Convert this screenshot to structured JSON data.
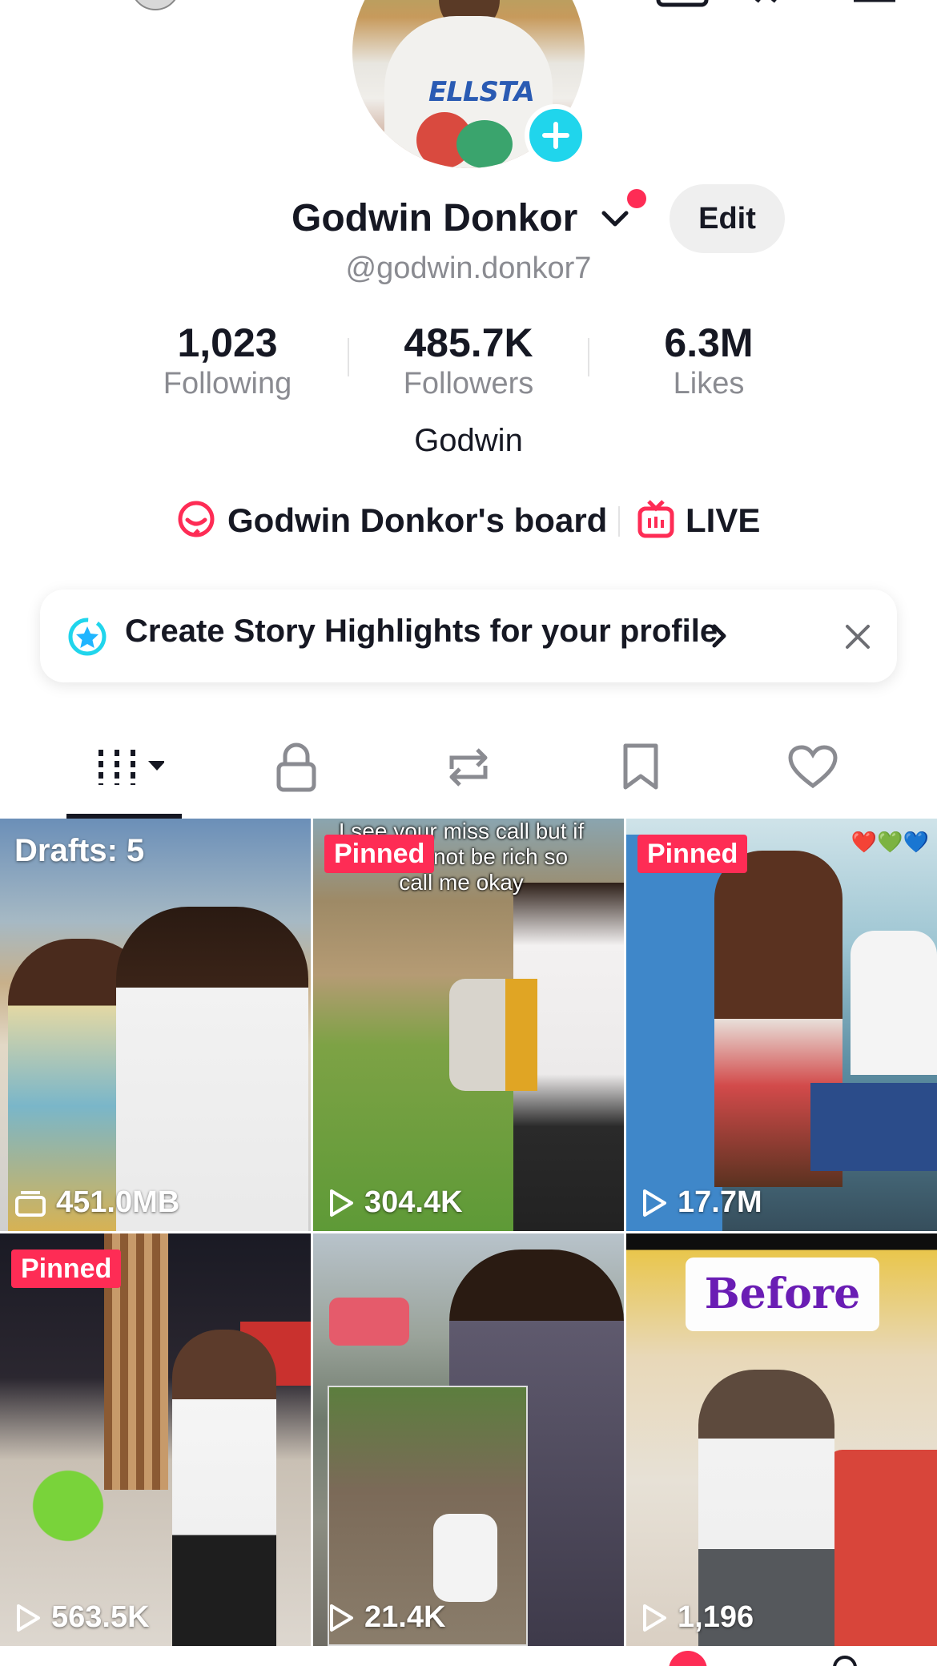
{
  "profile": {
    "display_name": "Godwin Donkor",
    "handle": "@godwin.donkor7",
    "edit_label": "Edit",
    "bio": "Godwin"
  },
  "stats": [
    {
      "value": "1,023",
      "label": "Following"
    },
    {
      "value": "485.7K",
      "label": "Followers"
    },
    {
      "value": "6.3M",
      "label": "Likes"
    }
  ],
  "links": {
    "board_label": "Godwin Donkor's board",
    "live_label": "LIVE"
  },
  "story_prompt": {
    "text": "Create Story Highlights for your profile"
  },
  "tabs": [
    {
      "name": "videos",
      "icon": "grid-icon",
      "active": true
    },
    {
      "name": "private",
      "icon": "lock-icon",
      "active": false
    },
    {
      "name": "reposts",
      "icon": "repost-icon",
      "active": false
    },
    {
      "name": "saved",
      "icon": "bookmark-icon",
      "active": false
    },
    {
      "name": "liked",
      "icon": "heart-icon",
      "active": false
    }
  ],
  "videos": [
    {
      "drafts_label": "Drafts: 5",
      "stat": "451.0MB",
      "stat_icon": "drafts-icon"
    },
    {
      "badge": "Pinned",
      "stat": "304.4K",
      "caption": "I see your miss call but if you cannot be rich so call me okay"
    },
    {
      "badge": "Pinned",
      "stat": "17.7M",
      "caption": "❤️💚💙"
    },
    {
      "badge": "Pinned",
      "stat": "563.5K"
    },
    {
      "stat": "21.4K"
    },
    {
      "stat": "1,196",
      "overlay_text": "Before"
    }
  ],
  "colors": {
    "accent_red": "#fe2c55",
    "accent_cyan": "#20d5ec",
    "text_primary": "#161823",
    "text_secondary": "#8a8b91"
  }
}
